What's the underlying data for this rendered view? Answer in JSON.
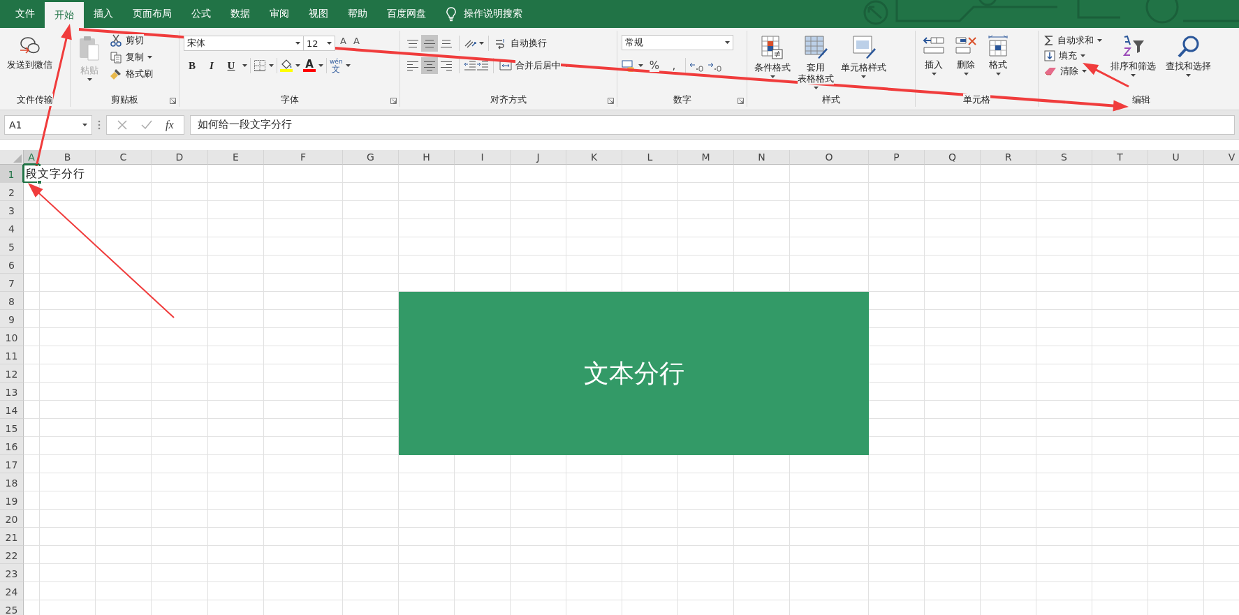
{
  "menu_tabs": [
    {
      "label": "文件",
      "selected": false
    },
    {
      "label": "开始",
      "selected": true
    },
    {
      "label": "插入",
      "selected": false
    },
    {
      "label": "页面布局",
      "selected": false
    },
    {
      "label": "公式",
      "selected": false
    },
    {
      "label": "数据",
      "selected": false
    },
    {
      "label": "审阅",
      "selected": false
    },
    {
      "label": "视图",
      "selected": false
    },
    {
      "label": "帮助",
      "selected": false
    },
    {
      "label": "百度网盘",
      "selected": false
    }
  ],
  "tell_me": {
    "label": "操作说明搜索"
  },
  "ribbon": {
    "file_transfer": {
      "label": "文件传输",
      "button": "发送到微信"
    },
    "clipboard": {
      "label": "剪贴板",
      "paste": {
        "label": "粘贴",
        "disabled": true
      },
      "items": [
        {
          "label": "剪切"
        },
        {
          "label": "复制"
        },
        {
          "label": "格式刷"
        }
      ]
    },
    "font": {
      "label": "字体",
      "font_name": "宋体",
      "font_size": "12",
      "size_buttons": [
        "A",
        "A"
      ],
      "style_buttons": [
        "B",
        "I",
        "U"
      ],
      "fill_color": {
        "color": "#ffff00"
      },
      "font_color": {
        "label": "A",
        "color": "#ff0000"
      },
      "phonetic": {
        "top": "wén",
        "bottom": "文"
      }
    },
    "alignment": {
      "label": "对齐方式",
      "vertical": [
        {
          "selected": false
        },
        {
          "selected": true
        },
        {
          "selected": false
        }
      ],
      "horizontal": [
        {
          "selected": false
        },
        {
          "selected": true
        },
        {
          "selected": false
        }
      ],
      "wrap": "自动换行",
      "merge": "合并后居中"
    },
    "number": {
      "label": "数字",
      "format": "常规",
      "symbols": [
        "%",
        ","
      ]
    },
    "styles": {
      "label": "样式",
      "buttons": [
        {
          "lines": [
            "条件格式"
          ]
        },
        {
          "lines": [
            "套用",
            "表格格式"
          ]
        },
        {
          "lines": [
            "单元格样式"
          ]
        }
      ]
    },
    "cells": {
      "label": "单元格",
      "buttons": [
        "插入",
        "删除",
        "格式"
      ]
    },
    "editing": {
      "label": "编辑",
      "items": [
        "自动求和",
        "填充",
        "清除"
      ],
      "buttons": [
        "排序和筛选",
        "查找和选择"
      ]
    }
  },
  "formula_bar": {
    "name_box": "A1",
    "fx": "fx",
    "formula": "如何给一段文字分行"
  },
  "sheet": {
    "columns": [
      "A",
      "B",
      "C",
      "D",
      "E",
      "F",
      "G",
      "H",
      "I",
      "J",
      "K",
      "L",
      "M",
      "N",
      "O",
      "P",
      "Q",
      "R",
      "S",
      "T",
      "U",
      "V"
    ],
    "rows": [
      {
        "label": "1",
        "cells": [
          {
            "text": "段文字分行",
            "selected": true
          }
        ]
      },
      {
        "label": "2"
      },
      {
        "label": "3"
      },
      {
        "label": "4"
      },
      {
        "label": "5"
      },
      {
        "label": "6"
      },
      {
        "label": "7"
      },
      {
        "label": "8"
      },
      {
        "label": "9"
      },
      {
        "label": "10"
      },
      {
        "label": "11"
      },
      {
        "label": "12"
      },
      {
        "label": "13"
      },
      {
        "label": "14"
      },
      {
        "label": "15"
      },
      {
        "label": "16"
      },
      {
        "label": "17"
      },
      {
        "label": "18"
      },
      {
        "label": "19"
      },
      {
        "label": "20"
      },
      {
        "label": "21"
      },
      {
        "label": "22"
      },
      {
        "label": "23"
      },
      {
        "label": "24"
      },
      {
        "label": "25"
      }
    ],
    "shape": {
      "text": "文本分行",
      "color": "#339a67"
    }
  }
}
